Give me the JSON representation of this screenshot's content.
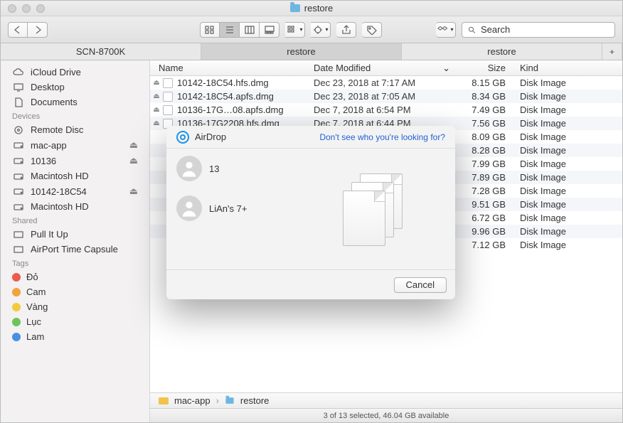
{
  "window": {
    "title": "restore"
  },
  "toolbar": {
    "search_placeholder": "Search"
  },
  "tabs": [
    {
      "label": "SCN-8700K",
      "active": false
    },
    {
      "label": "restore",
      "active": true
    },
    {
      "label": "restore",
      "active": false
    }
  ],
  "sidebar": {
    "favorites": [
      {
        "label": "iCloud Drive",
        "icon": "cloud"
      },
      {
        "label": "Desktop",
        "icon": "desktop"
      },
      {
        "label": "Documents",
        "icon": "doc"
      }
    ],
    "devices_header": "Devices",
    "devices": [
      {
        "label": "Remote Disc",
        "icon": "disc",
        "eject": false
      },
      {
        "label": "mac-app",
        "icon": "drive",
        "eject": true
      },
      {
        "label": "10136",
        "icon": "drive",
        "eject": true
      },
      {
        "label": "Macintosh HD",
        "icon": "drive",
        "eject": false
      },
      {
        "label": "10142-18C54",
        "icon": "drive",
        "eject": true
      },
      {
        "label": "Macintosh HD",
        "icon": "drive",
        "eject": false
      }
    ],
    "shared_header": "Shared",
    "shared": [
      {
        "label": "Pull It Up",
        "icon": "net"
      },
      {
        "label": "AirPort Time Capsule",
        "icon": "net"
      }
    ],
    "tags_header": "Tags",
    "tags": [
      {
        "label": "Đỏ",
        "color": "#ec5b4f"
      },
      {
        "label": "Cam",
        "color": "#f1a33c"
      },
      {
        "label": "Vàng",
        "color": "#f1cb3c"
      },
      {
        "label": "Lục",
        "color": "#6fc35b"
      },
      {
        "label": "Lam",
        "color": "#4a90e2"
      }
    ]
  },
  "columns": {
    "name": "Name",
    "date": "Date Modified",
    "size": "Size",
    "kind": "Kind"
  },
  "files": [
    {
      "name": "10142-18C54.hfs.dmg",
      "date": "Dec 23, 2018 at 7:17 AM",
      "size": "8.15 GB",
      "kind": "Disk Image"
    },
    {
      "name": "10142-18C54.apfs.dmg",
      "date": "Dec 23, 2018 at 7:05 AM",
      "size": "8.34 GB",
      "kind": "Disk Image"
    },
    {
      "name": "10136-17G…08.apfs.dmg",
      "date": "Dec 7, 2018 at 6:54 PM",
      "size": "7.49 GB",
      "kind": "Disk Image"
    },
    {
      "name": "10136-17G2208.hfs.dmg",
      "date": "Dec 7, 2018 at 6:44 PM",
      "size": "7.56 GB",
      "kind": "Disk Image"
    },
    {
      "name": "",
      "date": "",
      "size": "8.09 GB",
      "kind": "Disk Image"
    },
    {
      "name": "",
      "date": "",
      "size": "8.28 GB",
      "kind": "Disk Image"
    },
    {
      "name": "",
      "date": "",
      "size": "7.99 GB",
      "kind": "Disk Image"
    },
    {
      "name": "",
      "date": "",
      "size": "7.89 GB",
      "kind": "Disk Image"
    },
    {
      "name": "",
      "date": "",
      "size": "7.28 GB",
      "kind": "Disk Image"
    },
    {
      "name": "",
      "date": "",
      "size": "9.51 GB",
      "kind": "Disk Image"
    },
    {
      "name": "",
      "date": "",
      "size": "6.72 GB",
      "kind": "Disk Image"
    },
    {
      "name": "",
      "date": "",
      "size": "9.96 GB",
      "kind": "Disk Image"
    },
    {
      "name": "",
      "date": "",
      "size": "7.12 GB",
      "kind": "Disk Image"
    }
  ],
  "pathbar": [
    {
      "label": "mac-app",
      "icon": "drive"
    },
    {
      "label": "restore",
      "icon": "folder"
    }
  ],
  "status": "3 of 13 selected, 46.04 GB available",
  "modal": {
    "title": "AirDrop",
    "help_link": "Don't see who you're looking for?",
    "recipients": [
      {
        "name": "13"
      },
      {
        "name": "LiAn's 7+"
      }
    ],
    "cancel_label": "Cancel"
  }
}
